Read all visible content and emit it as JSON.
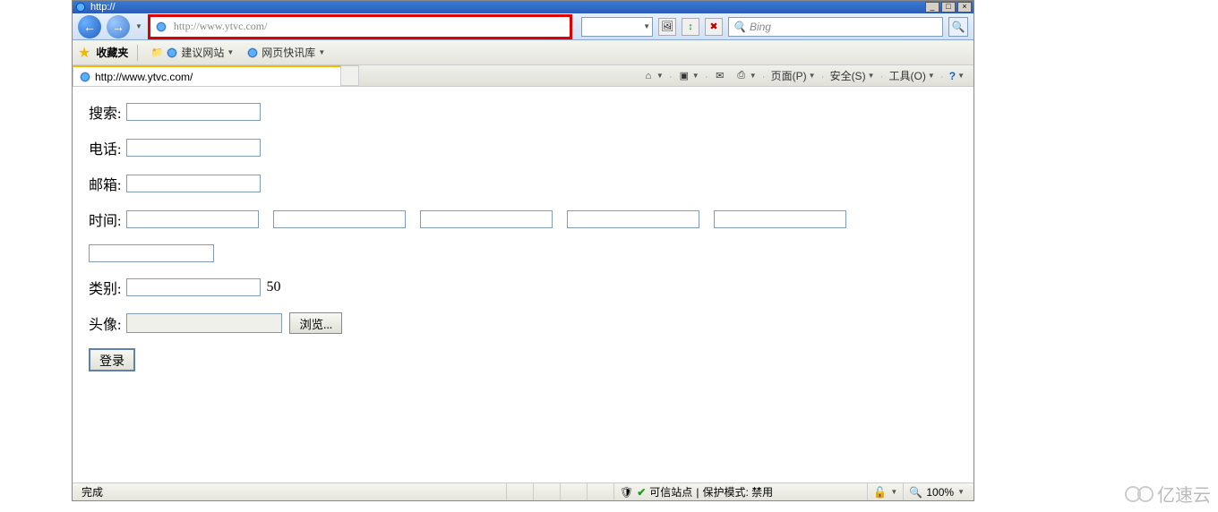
{
  "window": {
    "title_prefix": "http://",
    "min": "_",
    "max": "□",
    "close": "×"
  },
  "nav": {
    "url": "http://www.ytvc.com/"
  },
  "toolbar_icons": {
    "pic": "🖼",
    "go": "↕",
    "stop": "✖"
  },
  "search": {
    "placeholder": "Bing",
    "icon": "🔍"
  },
  "favbar": {
    "label": "收藏夹",
    "items": [
      "建议网站",
      "网页快讯库"
    ]
  },
  "tab": {
    "title": "http://www.ytvc.com/"
  },
  "menus": {
    "home": "⌂",
    "rss": "▣",
    "mail": "✉",
    "print": "⎙",
    "page": "页面(P)",
    "safety": "安全(S)",
    "tools": "工具(O)",
    "help": "?"
  },
  "form": {
    "search_label": "搜索:",
    "phone_label": "电话:",
    "email_label": "邮箱:",
    "time_label": "时间:",
    "category_label": "类别:",
    "category_suffix": "50",
    "avatar_label": "头像:",
    "browse": "浏览...",
    "submit": "登录"
  },
  "status": {
    "done": "完成",
    "trusted": "可信站点",
    "protect": "保护模式: 禁用",
    "zoom": "100%"
  },
  "watermark": "亿速云"
}
